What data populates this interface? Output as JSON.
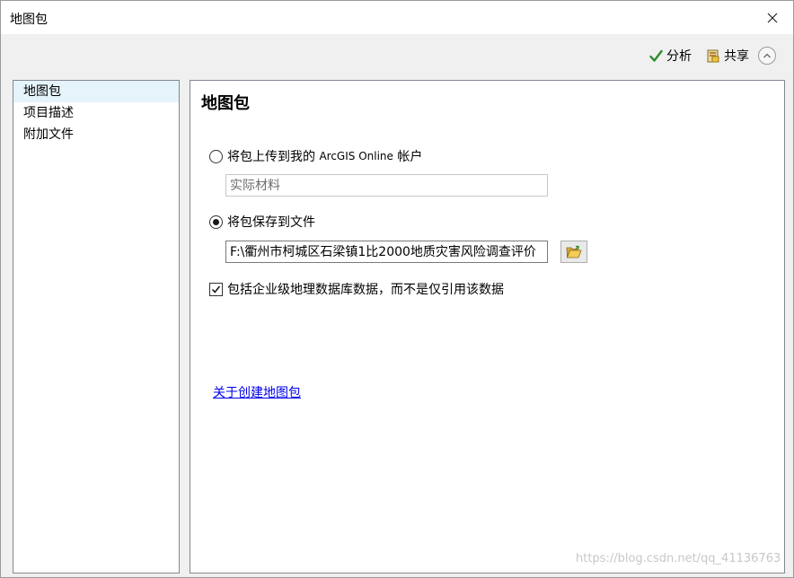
{
  "window": {
    "title": "地图包"
  },
  "toolbar": {
    "analyze_label": "分析",
    "share_label": "共享"
  },
  "sidebar": {
    "items": [
      {
        "label": "地图包",
        "selected": true
      },
      {
        "label": "项目描述"
      },
      {
        "label": "附加文件"
      }
    ]
  },
  "main": {
    "title": "地图包",
    "upload_option": {
      "label_prefix": "将包上传到我的 ",
      "label_arcgis": "ArcGIS Online",
      "label_suffix": " 帐户",
      "selected": false
    },
    "upload_field": {
      "value": "实际材料"
    },
    "save_option": {
      "label": "将包保存到文件",
      "selected": true
    },
    "save_path": {
      "value": "F:\\衢州市柯城区石梁镇1比2000地质灾害风险调查评价"
    },
    "include_gdb": {
      "label": "包括企业级地理数据库数据，而不是仅引用该数据",
      "checked": true
    },
    "help_link": "关于创建地图包"
  },
  "watermark": "https://blog.csdn.net/qq_41136763",
  "colors": {
    "link": "#0000ee",
    "selected_bg": "#e5f3fb",
    "check_green": "#2e8b2e"
  },
  "icons": [
    "close-icon",
    "checkmark-icon",
    "share-icon",
    "chevron-up-icon",
    "folder-open-icon"
  ]
}
